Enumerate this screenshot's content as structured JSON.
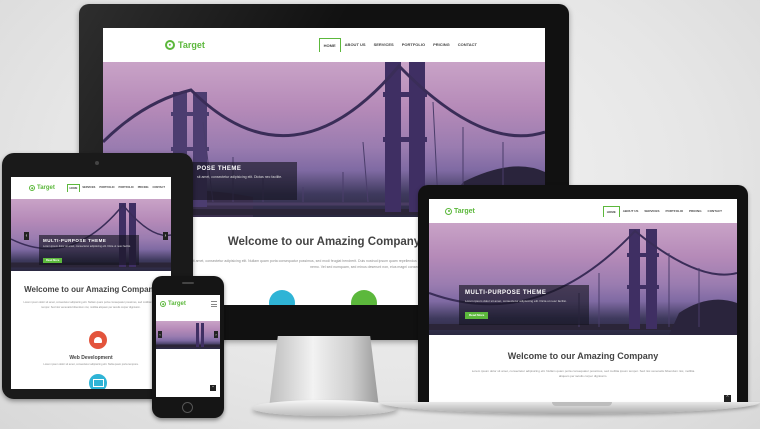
{
  "brand": {
    "name": "Target",
    "accent": "#5cb83c"
  },
  "menu": {
    "desktop": [
      "HOME",
      "ABOUT US",
      "SERVICES",
      "PORTFOLIO",
      "PRICING",
      "CONTACT"
    ],
    "tablet": [
      "HOME",
      "SERVICES",
      "PORTFOLIO",
      "PORTFOLIO",
      "PRICING",
      "CONTACT"
    ],
    "laptop": [
      "HOME",
      "ABOUT US",
      "SERVICES",
      "PORTFOLIO",
      "PRICING",
      "CONTACT"
    ]
  },
  "hero": {
    "theme_title_desktop": "POSE THEME",
    "theme_title": "MULTI-PURPOSE THEME",
    "theme_text": "Lorem ipsum dolor sit amet, consectetur adipisicing elit. Dicta ut nesc facilisi.",
    "theme_text_desktop": "sit amet, consectetur adipisicing elit. Dictas nec facilite.",
    "button": "Read More"
  },
  "welcome": {
    "heading": "Welcome to our Amazing Company",
    "body": "Lorem ipsum dolor sit amet, consectetur adipisicing elit. Nullam quam porta consequatur possimus, sed mollitia ipsum tempor. Sed nisi venenatis bibendum nisi, mollitia aliquam per iaculis corper dignissim.",
    "body_desktop": "orem ipsum dolor sit amet, consectetur adipisicing elit. Nullam quam porta consequatur possimus, sed modi feugiat hendrerit. Duis nostrud ipsum quam repellendus nulla nemo rerum velit sed corrupti consequatur possimus, sed modi fugit. Vel, ut ipsum laborum voluptatem nemo. Vel sed numquam, sed minus deserunt non, eius magni consequatur quam."
  },
  "service": {
    "label": "Web Development",
    "text": "Lorem ipsum dolor sit amet, consectetur adipisicing elit. Nulla quam porta tempora."
  },
  "colors": {
    "teal": "#2fb4d6",
    "green": "#5cb83c",
    "red": "#e3543c"
  }
}
